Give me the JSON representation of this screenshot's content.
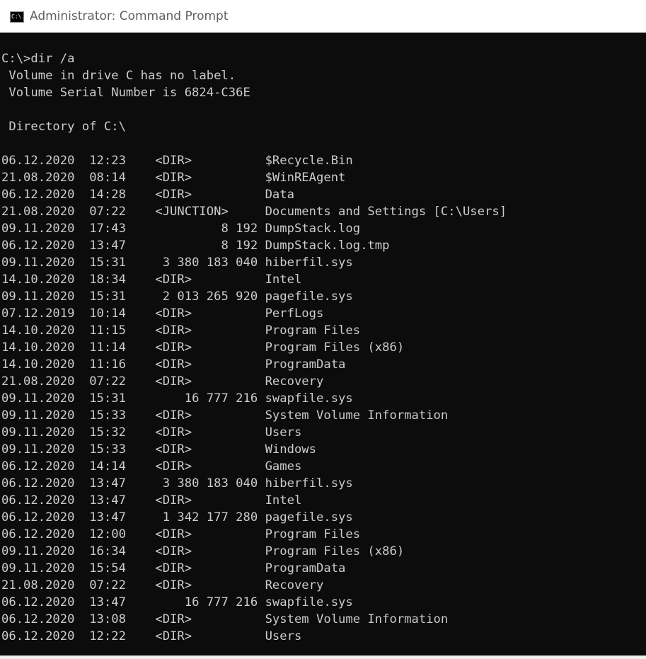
{
  "window": {
    "title": "Administrator: Command Prompt",
    "icon_text": "C:\\."
  },
  "console": {
    "command": "C:\\>dir /a",
    "volume_label_line": " Volume in drive C has no label.",
    "serial_line": " Volume Serial Number is 6824-C36E",
    "directory_line": " Directory of C:\\",
    "entries": [
      {
        "date": "06.12.2020",
        "time": "12:23",
        "size": "<DIR>",
        "name": "$Recycle.Bin"
      },
      {
        "date": "21.08.2020",
        "time": "08:14",
        "size": "<DIR>",
        "name": "$WinREAgent"
      },
      {
        "date": "06.12.2020",
        "time": "14:28",
        "size": "<DIR>",
        "name": "Data"
      },
      {
        "date": "21.08.2020",
        "time": "07:22",
        "size": "<JUNCTION>",
        "name": "Documents and Settings [C:\\Users]"
      },
      {
        "date": "09.11.2020",
        "time": "17:43",
        "size": "8 192",
        "name": "DumpStack.log"
      },
      {
        "date": "06.12.2020",
        "time": "13:47",
        "size": "8 192",
        "name": "DumpStack.log.tmp"
      },
      {
        "date": "09.11.2020",
        "time": "15:31",
        "size": "3 380 183 040",
        "name": "hiberfil.sys"
      },
      {
        "date": "14.10.2020",
        "time": "18:34",
        "size": "<DIR>",
        "name": "Intel"
      },
      {
        "date": "09.11.2020",
        "time": "15:31",
        "size": "2 013 265 920",
        "name": "pagefile.sys"
      },
      {
        "date": "07.12.2019",
        "time": "10:14",
        "size": "<DIR>",
        "name": "PerfLogs"
      },
      {
        "date": "14.10.2020",
        "time": "11:15",
        "size": "<DIR>",
        "name": "Program Files"
      },
      {
        "date": "14.10.2020",
        "time": "11:14",
        "size": "<DIR>",
        "name": "Program Files (x86)"
      },
      {
        "date": "14.10.2020",
        "time": "11:16",
        "size": "<DIR>",
        "name": "ProgramData"
      },
      {
        "date": "21.08.2020",
        "time": "07:22",
        "size": "<DIR>",
        "name": "Recovery"
      },
      {
        "date": "09.11.2020",
        "time": "15:31",
        "size": "16 777 216",
        "name": "swapfile.sys"
      },
      {
        "date": "09.11.2020",
        "time": "15:33",
        "size": "<DIR>",
        "name": "System Volume Information"
      },
      {
        "date": "09.11.2020",
        "time": "15:32",
        "size": "<DIR>",
        "name": "Users"
      },
      {
        "date": "09.11.2020",
        "time": "15:33",
        "size": "<DIR>",
        "name": "Windows"
      },
      {
        "date": "06.12.2020",
        "time": "14:14",
        "size": "<DIR>",
        "name": "Games"
      },
      {
        "date": "06.12.2020",
        "time": "13:47",
        "size": "3 380 183 040",
        "name": "hiberfil.sys"
      },
      {
        "date": "06.12.2020",
        "time": "13:47",
        "size": "<DIR>",
        "name": "Intel"
      },
      {
        "date": "06.12.2020",
        "time": "13:47",
        "size": "1 342 177 280",
        "name": "pagefile.sys"
      },
      {
        "date": "06.12.2020",
        "time": "12:00",
        "size": "<DIR>",
        "name": "Program Files"
      },
      {
        "date": "09.11.2020",
        "time": "16:34",
        "size": "<DIR>",
        "name": "Program Files (x86)"
      },
      {
        "date": "09.11.2020",
        "time": "15:54",
        "size": "<DIR>",
        "name": "ProgramData"
      },
      {
        "date": "21.08.2020",
        "time": "07:22",
        "size": "<DIR>",
        "name": "Recovery"
      },
      {
        "date": "06.12.2020",
        "time": "13:47",
        "size": "16 777 216",
        "name": "swapfile.sys"
      },
      {
        "date": "06.12.2020",
        "time": "13:08",
        "size": "<DIR>",
        "name": "System Volume Information"
      },
      {
        "date": "06.12.2020",
        "time": "12:22",
        "size": "<DIR>",
        "name": "Users"
      }
    ]
  },
  "colors": {
    "console_background": "#0c0c0c",
    "console_text": "#cccccc",
    "titlebar_background": "#ffffff",
    "titlebar_text": "#5f5f5f"
  }
}
